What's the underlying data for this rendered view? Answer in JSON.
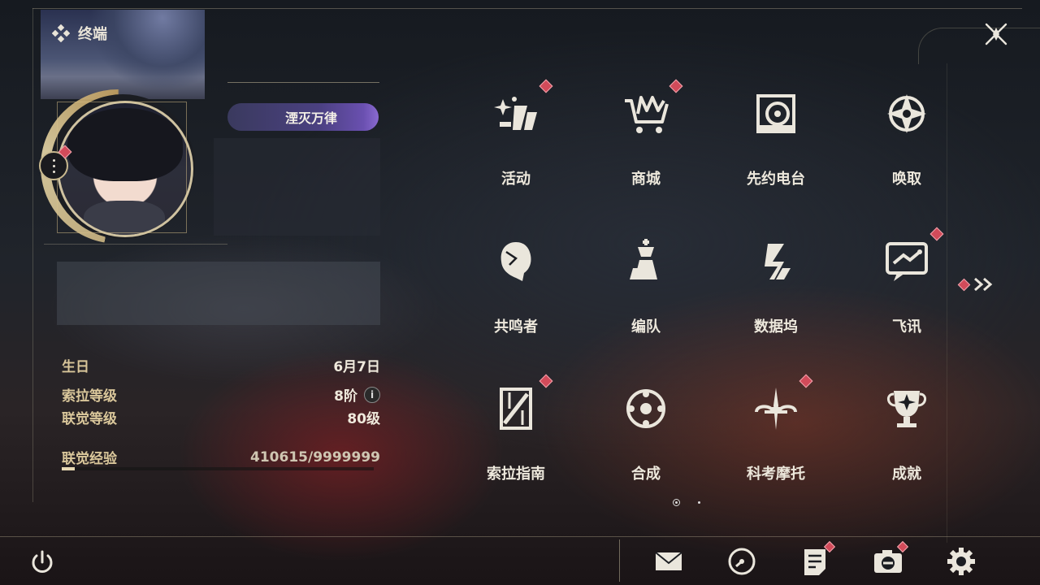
{
  "header": {
    "title": "终端"
  },
  "profile": {
    "title_badge": "湮灭万律",
    "stats": [
      {
        "label": "生日",
        "value": "6月7日"
      },
      {
        "label": "索拉等级",
        "value": "8阶"
      },
      {
        "label": "联觉等级",
        "value": "80级"
      }
    ],
    "exp": {
      "label": "联觉经验",
      "value": "410615/9999999",
      "progress": 0.041
    },
    "info_icon_glyph": "i"
  },
  "menu": {
    "rows": [
      [
        {
          "label": "活动",
          "icon": "activity-icon",
          "badge": true
        },
        {
          "label": "商城",
          "icon": "shop-icon",
          "badge": true
        },
        {
          "label": "先约电台",
          "icon": "radio-icon",
          "badge": false
        },
        {
          "label": "唤取",
          "icon": "convene-icon",
          "badge": false
        }
      ],
      [
        {
          "label": "共鸣者",
          "icon": "resonator-icon",
          "badge": false
        },
        {
          "label": "编队",
          "icon": "team-icon",
          "badge": false
        },
        {
          "label": "数据坞",
          "icon": "data-bank-icon",
          "badge": false
        },
        {
          "label": "飞讯",
          "icon": "message-icon",
          "badge": true
        }
      ],
      [
        {
          "label": "索拉指南",
          "icon": "guide-icon",
          "badge": true
        },
        {
          "label": "合成",
          "icon": "synthesis-icon",
          "badge": false
        },
        {
          "label": "科考摩托",
          "icon": "motorcycle-icon",
          "badge": true
        },
        {
          "label": "成就",
          "icon": "achievement-icon",
          "badge": false
        }
      ]
    ],
    "pages": {
      "current": 1,
      "total": 2
    }
  },
  "bottom_bar": {
    "icons": [
      "mail-icon",
      "clock-icon",
      "notice-icon",
      "camera-icon",
      "settings-icon"
    ]
  },
  "colors": {
    "accent_gold": "#d9c69a",
    "badge_red": "#d24b5a"
  }
}
